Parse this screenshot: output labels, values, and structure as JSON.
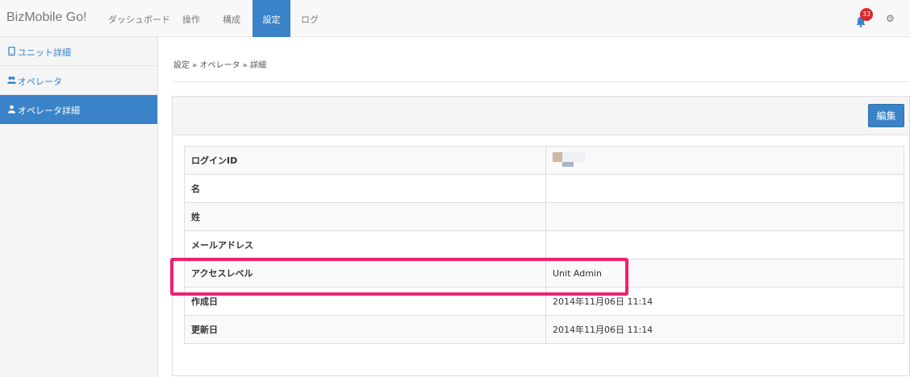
{
  "navbar": {
    "brand": "BizMobile Go!",
    "items": [
      {
        "label": "ダッシュボード"
      },
      {
        "label": "操作"
      },
      {
        "label": "構成"
      },
      {
        "label": "設定",
        "active": true
      },
      {
        "label": "ログ"
      }
    ],
    "notification_count": "33",
    "accent_color": "#3a83c9",
    "badge_color": "#d9262a"
  },
  "sidebar": {
    "items": [
      {
        "label": "ユニット詳細",
        "icon": "device-icon"
      },
      {
        "label": "オペレータ",
        "icon": "users-icon"
      },
      {
        "label": "オペレータ詳細",
        "icon": "user-icon",
        "active": true
      }
    ]
  },
  "breadcrumb": "設定 » オペレータ » 詳細",
  "panel": {
    "edit_label": "編集"
  },
  "details": [
    {
      "key": "ログインID",
      "value": ""
    },
    {
      "key": "名",
      "value": ""
    },
    {
      "key": "姓",
      "value": ""
    },
    {
      "key": "メールアドレス",
      "value": ""
    },
    {
      "key": "アクセスレベル",
      "value": "Unit Admin"
    },
    {
      "key": "作成日",
      "value": "2014年11月06日 11:14"
    },
    {
      "key": "更新日",
      "value": "2014年11月06日 11:14"
    }
  ],
  "highlight_color": "#f0206f"
}
